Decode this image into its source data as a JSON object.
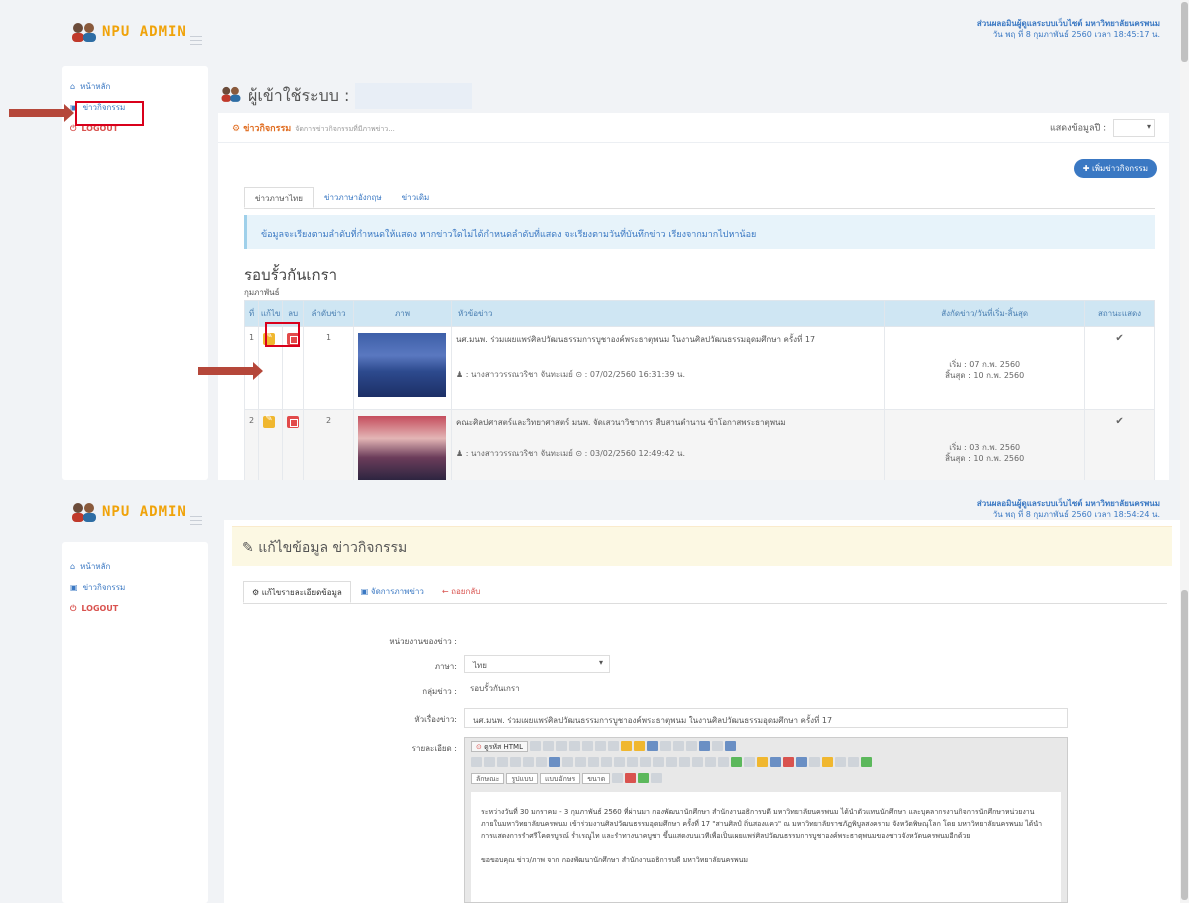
{
  "app": {
    "brand": "NPU ADMIN"
  },
  "shot1": {
    "user_name": "ส่วนผลอมินผู้ดูแลระบบเว็บไซต์ มหาวิทยาลัยนครพนม",
    "datetime": "วัน พฤ ที่ 8 กุมภาพันธ์ 2560  เวลา 18:45:17  น.",
    "sidebar": [
      {
        "label": "หน้าหลัก",
        "icon": "home-icon"
      },
      {
        "label": "ข่าวกิจกรรม",
        "icon": "image-icon"
      },
      {
        "label": "LOGOUT",
        "icon": "power-icon"
      }
    ],
    "page_title": "ผู้เข้าใช้ระบบ :",
    "panel_title": "ข่าวกิจกรรม",
    "panel_subtitle": "จัดการข่าวกิจกรรมที่มีภาพข่าว...",
    "show_label": "แสดงข้อมูลปี :",
    "add_button": "เพิ่มข่าวกิจกรรม",
    "tabs": [
      "ข่าวภาษาไทย",
      "ข่าวภาษาอังกฤษ",
      "ข่าวเดิม"
    ],
    "info": "ข้อมูลจะเรียงตามลำดับที่กำหนดให้แสดง หากข่าวใดไม่ได้กำหนดลำดับที่แสดง จะเรียงตามวันที่บันทึกข่าว เรียงจากมากไปหาน้อย",
    "group_title": "รอบรั้วกันเกรา",
    "month": "กุมภาพันธ์",
    "table_headers": [
      "ที่",
      "แก้ไข",
      "ลบ",
      "ลำดับข่าว",
      "ภาพ",
      "หัวข้อข่าว",
      "สังกัดข่าว/วันที่เริ่ม-สิ้นสุด",
      "สถานะแสดง"
    ],
    "rows": [
      {
        "no": "1",
        "order": "1",
        "title": "นศ.มนพ. ร่วมเผยแพร่ศิลปวัฒนธรรมการบูชาองค์พระธาตุพนม ในงานศิลปวัฒนธรรมอุดมศึกษา ครั้งที่ 17",
        "meta": " : นางสาววรรณวริชา จันทะเมย์ ⊙ : 07/02/2560 16:31:39 น.",
        "start": "เริ่ม : 07 ก.พ. 2560",
        "end": "สิ้นสุด : 10 ก.พ. 2560",
        "status": "✔"
      },
      {
        "no": "2",
        "order": "2",
        "title": "คณะศิลปศาสตร์และวิทยาศาสตร์ มนพ. จัดเสวนาวิชาการ สืบสานตำนาน ข้าโอกาสพระธาตุพนม",
        "meta": " : นางสาววรรณวริชา จันทะเมย์ ⊙ : 03/02/2560 12:49:42 น.",
        "start": "เริ่ม : 03 ก.พ. 2560",
        "end": "สิ้นสุด : 10 ก.พ. 2560",
        "status": "✔"
      }
    ]
  },
  "shot2": {
    "user_name": "ส่วนผลอมินผู้ดูแลระบบเว็บไซต์ มหาวิทยาลัยนครพนม",
    "datetime": "วัน พฤ ที่ 8 กุมภาพันธ์ 2560  เวลา 18:54:24  น.",
    "sidebar": [
      {
        "label": "หน้าหลัก",
        "icon": "home-icon"
      },
      {
        "label": "ข่าวกิจกรรม",
        "icon": "image-icon"
      },
      {
        "label": "LOGOUT",
        "icon": "power-icon"
      }
    ],
    "edit_title": "แก้ไขข้อมูล ข่าวกิจกรรม",
    "tabs": [
      "แก้ไขรายละเอียดข้อมูล",
      "จัดการภาพข่าว",
      "ถอยกลับ"
    ],
    "form": {
      "unit_label": "หน่วยงานของข่าว :",
      "lang_label": "ภาษา:",
      "lang_value": "ไทย",
      "group_label": "กลุ่มข่าว :",
      "group_value": "รอบรั้วกันเกรา",
      "title_label": "หัวเรื่องข่าว:",
      "title_value": "นศ.มนพ. ร่วมเผยแพร่ศิลปวัฒนธรรมการบูชาองค์พระธาตุพนม ในงานศิลปวัฒนธรรมอุดมศึกษา ครั้งที่ 17",
      "detail_label": "รายละเอียด :"
    },
    "editor": {
      "source_label": "ดูรหัส HTML",
      "font_dd": "ลักษณะ",
      "format_dd": "รูปแบบ",
      "fontname_dd": "แบบอักษร",
      "size_dd": "ขนาด",
      "body_p1": "ระหว่างวันที่ 30 มกราคม - 3 กุมภาพันธ์ 2560 ที่ผ่านมา กองพัฒนานักศึกษา สำนักงานอธิการบดี มหาวิทยาลัยนครพนม ได้นำตัวแทนนักศึกษา และบุคลากรงานกิจการนักศึกษาหน่วยงานภายในมหาวิทยาลัยนครพนม เข้าร่วมงานศิลปวัฒนธรรมอุดมศึกษา ครั้งที่ 17 \"สานศิลป์ ถิ่นสองแคว\" ณ มหาวิทยาลัยราชภัฏพิบูลสงคราม จังหวัดพิษณุโลก โดย มหาวิทยาลัยนครพนม ได้นำการแสดงการรำศรีโคตรบูรณ์ ร่ำเรณูไท และรำทางนาคบูชา ขึ้นแสดงบนเวทีเพื่อเป็นเผยแพร่ศิลปวัฒนธรรมการบูชาองค์พระธาตุพนมของชาวจังหวัดนครพนมอีกด้วย",
      "body_p2": "ขอขอบคุณ ข่าว/ภาพ จาก กองพัฒนานักศึกษา สำนักงานอธิการบดี มหาวิทยาลัยนครพนม"
    }
  }
}
